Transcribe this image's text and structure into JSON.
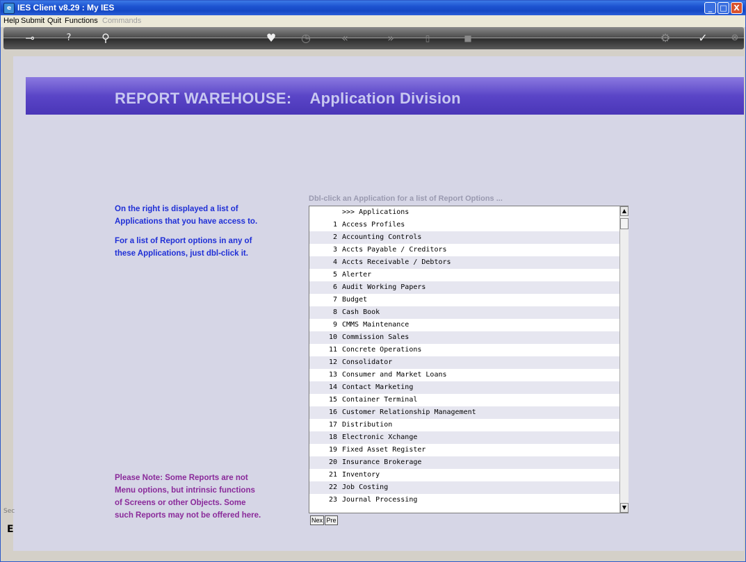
{
  "window": {
    "title": "IES Client v8.29 : My IES",
    "minimize": "_",
    "maximize": "□",
    "close": "X"
  },
  "menu": {
    "items": [
      "Help",
      "Submit",
      "Quit",
      "Functions",
      "Commands"
    ]
  },
  "toolbar": {
    "icons": [
      "key-icon",
      "help-icon",
      "search-icon",
      "heart-icon",
      "clock-icon",
      "rewind-icon",
      "fast-forward-icon",
      "edit-icon",
      "stop-icon",
      "settings-icon",
      "check-icon",
      "close-icon"
    ]
  },
  "header": {
    "title": "REPORT WAREHOUSE:",
    "subtitle": "Application Division"
  },
  "info": {
    "line1": "On the right is displayed a list of",
    "line2": "Applications that you have access to.",
    "line3": "For a list of Report options in any of",
    "line4": "these Applications, just dbl-click it.",
    "note1": "Please Note: Some Reports are not",
    "note2": "Menu options, but intrinsic functions",
    "note3": "of Screens or other Objects. Some",
    "note4": "such Reports may not be offered here."
  },
  "list": {
    "caption": "Dbl-click an Application for a list  of  Report Options ...",
    "header": ">>> Applications",
    "items": [
      {
        "num": "1",
        "name": "Access Profiles"
      },
      {
        "num": "2",
        "name": "Accounting Controls"
      },
      {
        "num": "3",
        "name": "Accts Payable / Creditors"
      },
      {
        "num": "4",
        "name": "Accts Receivable / Debtors"
      },
      {
        "num": "5",
        "name": "Alerter"
      },
      {
        "num": "6",
        "name": "Audit Working Papers"
      },
      {
        "num": "7",
        "name": "Budget"
      },
      {
        "num": "8",
        "name": "Cash Book"
      },
      {
        "num": "9",
        "name": "CMMS Maintenance"
      },
      {
        "num": "10",
        "name": "Commission Sales"
      },
      {
        "num": "11",
        "name": "Concrete Operations"
      },
      {
        "num": "12",
        "name": "Consolidator"
      },
      {
        "num": "13",
        "name": "Consumer and Market Loans"
      },
      {
        "num": "14",
        "name": "Contact Marketing"
      },
      {
        "num": "15",
        "name": "Container Terminal"
      },
      {
        "num": "16",
        "name": "Customer Relationship Management"
      },
      {
        "num": "17",
        "name": "Distribution"
      },
      {
        "num": "18",
        "name": "Electronic Xchange"
      },
      {
        "num": "19",
        "name": "Fixed Asset Register"
      },
      {
        "num": "20",
        "name": "Insurance Brokerage"
      },
      {
        "num": "21",
        "name": "Inventory"
      },
      {
        "num": "22",
        "name": "Job Costing"
      },
      {
        "num": "23",
        "name": "Journal Processing"
      }
    ],
    "next_label": "Nex",
    "prev_label": "Pre"
  },
  "footer": {
    "left_text": "Sec",
    "glyph": "E"
  }
}
